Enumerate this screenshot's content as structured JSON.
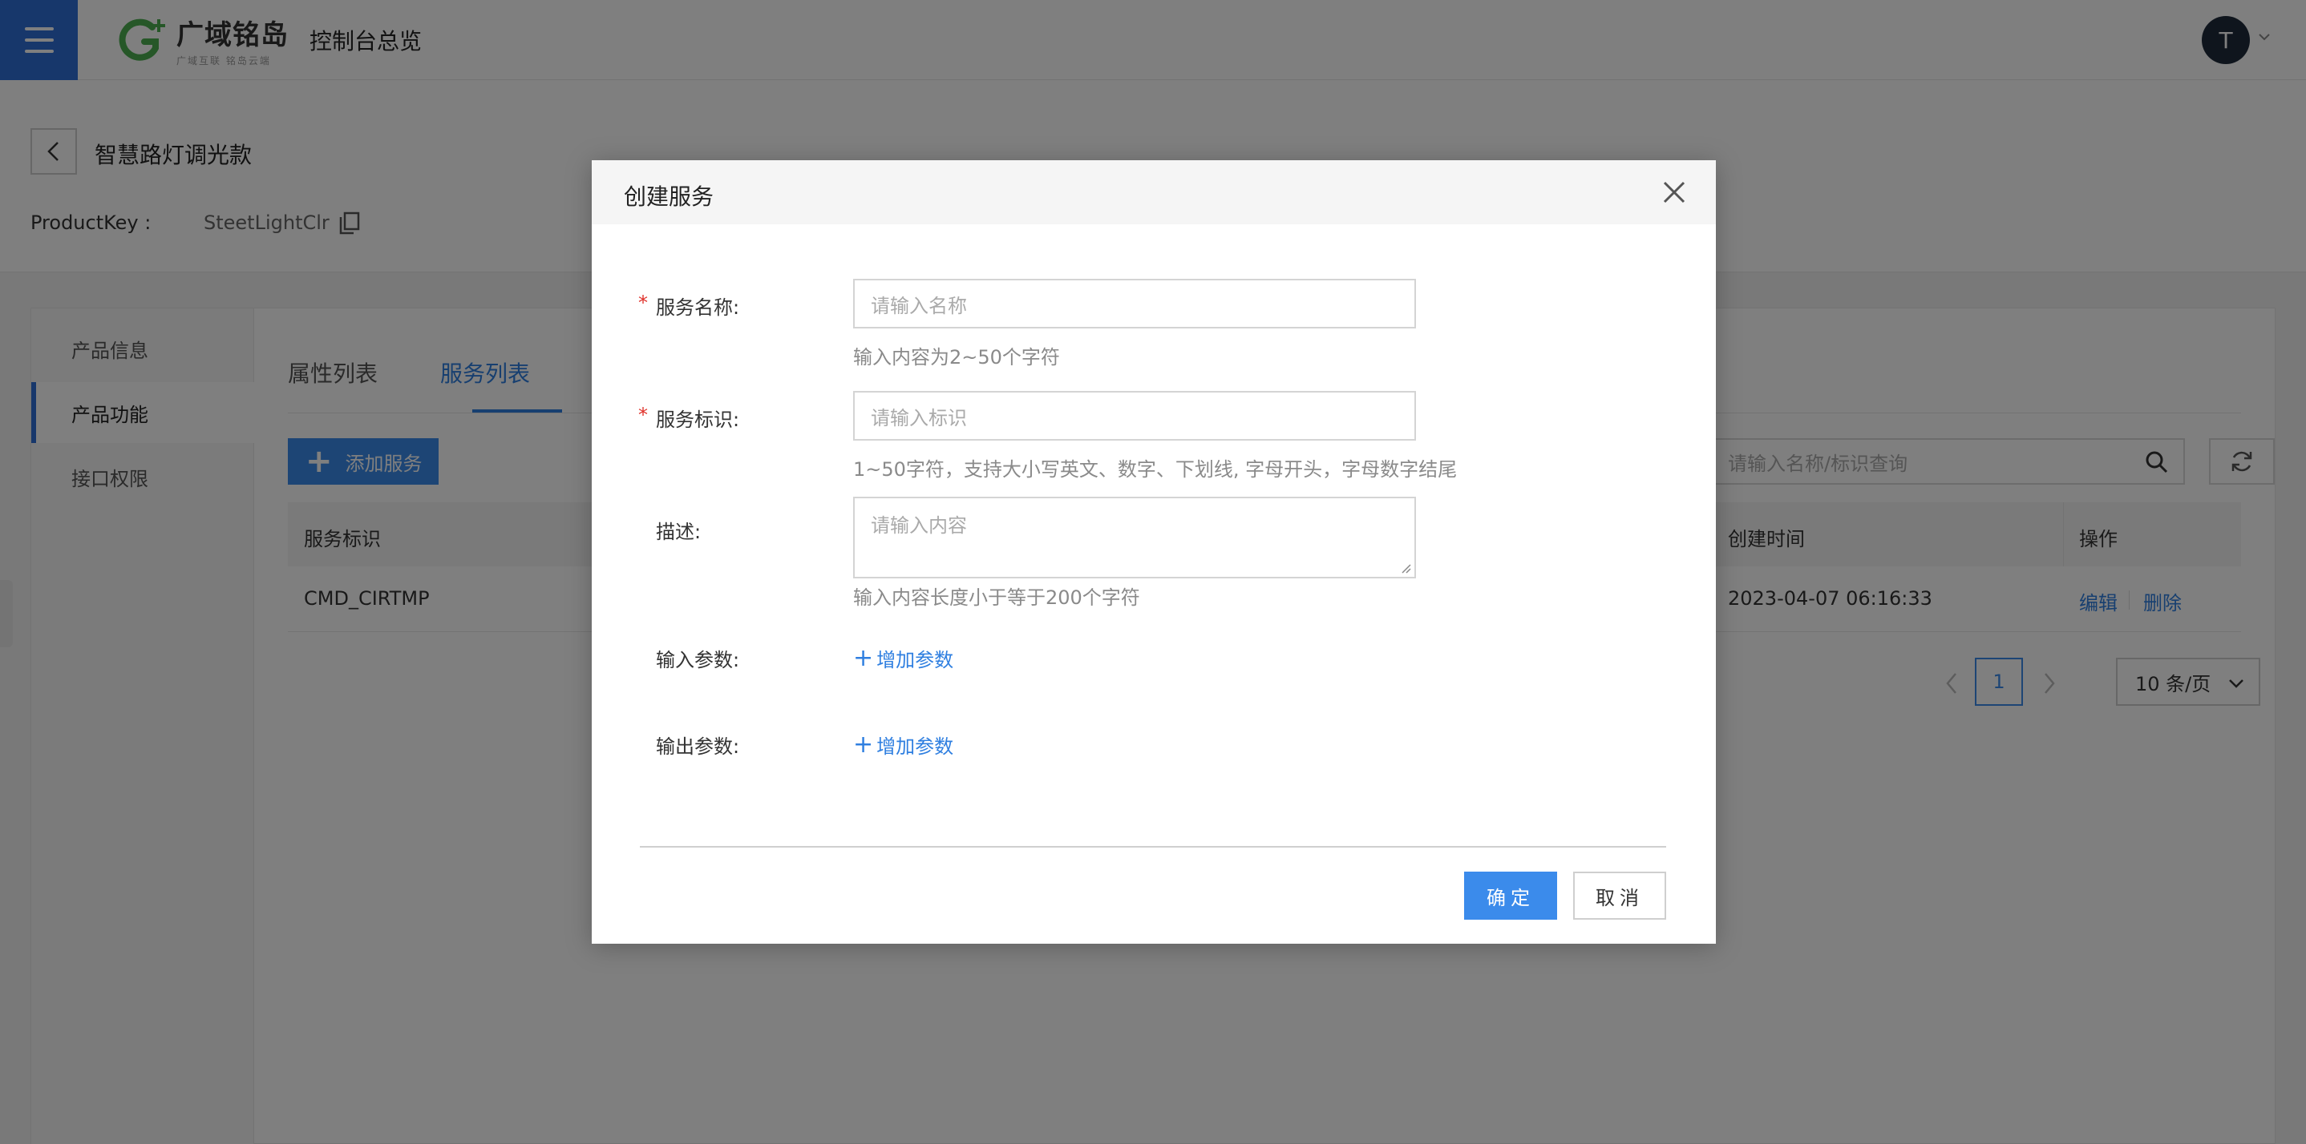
{
  "header": {
    "logo_name": "广域铭岛",
    "logo_sub": "广域互联 铭岛云端",
    "console_link": "控制台总览",
    "avatar_letter": "T"
  },
  "product": {
    "title": "智慧路灯调光款",
    "productkey_label": "ProductKey :",
    "productkey_value": "SteetLightClr"
  },
  "sidebar": {
    "items": [
      {
        "label": "产品信息",
        "active": false
      },
      {
        "label": "产品功能",
        "active": true
      },
      {
        "label": "接口权限",
        "active": false
      }
    ]
  },
  "tabs": [
    {
      "label": "属性列表",
      "active": false
    },
    {
      "label": "服务列表",
      "active": true
    }
  ],
  "toolbar": {
    "add_label": "添加服务",
    "search_placeholder": "请输入名称/标识查询"
  },
  "table": {
    "columns": [
      "服务标识",
      "创建时间",
      "操作"
    ],
    "rows": [
      {
        "id": "CMD_CIRTMP",
        "created": "2023-04-07 06:16:33",
        "edit": "编辑",
        "delete": "删除"
      }
    ]
  },
  "pagination": {
    "current_page": "1",
    "page_size": "10 条/页"
  },
  "modal": {
    "title": "创建服务",
    "fields": {
      "name_label": "服务名称:",
      "name_placeholder": "请输入名称",
      "name_hint": "输入内容为2~50个字符",
      "ident_label": "服务标识:",
      "ident_placeholder": "请输入标识",
      "ident_hint": "1~50字符，支持大小写英文、数字、下划线, 字母开头，字母数字结尾",
      "desc_label": "描述:",
      "desc_placeholder": "请输入内容",
      "desc_hint": "输入内容长度小于等于200个字符",
      "input_params_label": "输入参数:",
      "output_params_label": "输出参数:",
      "add_param": "增加参数",
      "required_mark": "*"
    },
    "ok_label": "确定",
    "cancel_label": "取消"
  },
  "colors": {
    "primary": "#3b8beb",
    "link": "#2f7fe0",
    "required": "#e0322b"
  }
}
